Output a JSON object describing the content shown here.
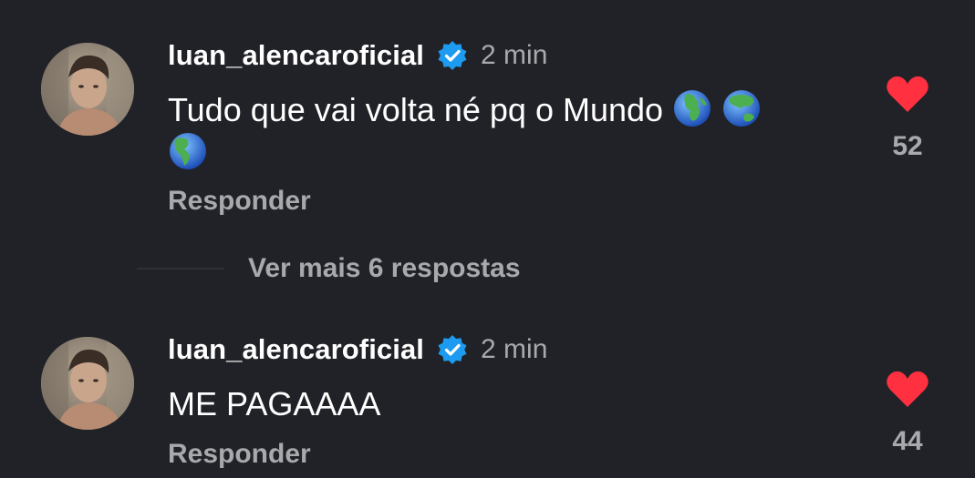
{
  "colors": {
    "background": "#212227",
    "text_primary": "#ffffff",
    "text_secondary": "#a8a9ad",
    "verified_blue": "#1d9bf0",
    "heart_red": "#ff3040"
  },
  "comments": [
    {
      "username": "luan_alencaroficial",
      "verified_icon": "verified-badge-icon",
      "timestamp": "2 min",
      "text": "Tudo que vai volta né pq o Mundo",
      "emojis": [
        "globe-europe-africa-emoji",
        "globe-asia-australia-emoji",
        "globe-americas-emoji"
      ],
      "reply_label": "Responder",
      "like_icon": "heart-icon",
      "like_count": "52"
    },
    {
      "username": "luan_alencaroficial",
      "verified_icon": "verified-badge-icon",
      "timestamp": "2 min",
      "text": "ME PAGAAAA",
      "emojis": [],
      "reply_label": "Responder",
      "like_icon": "heart-icon",
      "like_count": "44"
    }
  ],
  "more_replies_label": "Ver mais 6 respostas"
}
